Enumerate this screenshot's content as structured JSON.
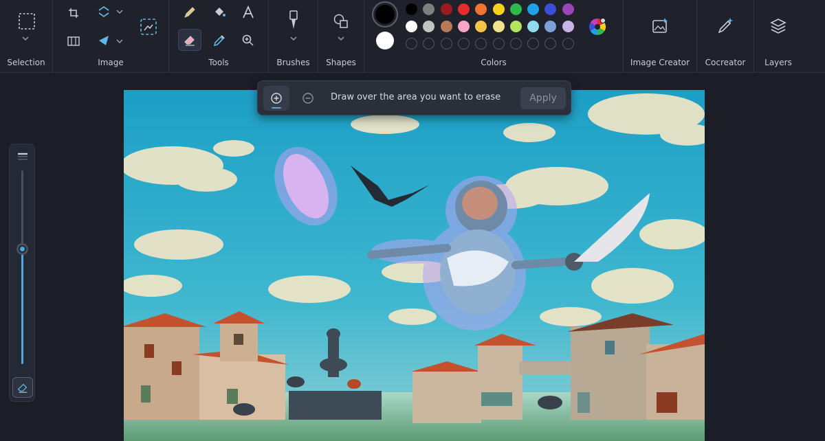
{
  "ribbon": {
    "groups": {
      "selection": "Selection",
      "image": "Image",
      "tools": "Tools",
      "brushes": "Brushes",
      "shapes": "Shapes",
      "colors": "Colors",
      "image_creator": "Image Creator",
      "cocreator": "Cocreator",
      "layers": "Layers"
    },
    "primary_color": "#000000",
    "secondary_color": "#ffffff",
    "palette_row1": [
      "#000000",
      "#7f7f7f",
      "#9b1c20",
      "#e62b2b",
      "#f2752f",
      "#f7d21d",
      "#2db84b",
      "#1ea1e8",
      "#3b4fd6",
      "#9a46b8"
    ],
    "palette_row2": [
      "#ffffff",
      "#c3c3c3",
      "#b97a56",
      "#f5a6c6",
      "#f7c34a",
      "#efe48d",
      "#b4e35f",
      "#8fdcef",
      "#7ea2d8",
      "#c6b4e6"
    ]
  },
  "erase_toolbar": {
    "hint": "Draw over the area you want to erase",
    "apply_label": "Apply"
  },
  "brush_size": {
    "level_fraction": 0.38
  }
}
